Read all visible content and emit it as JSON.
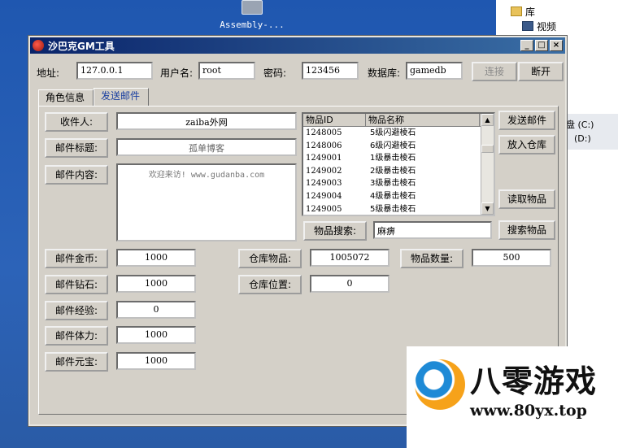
{
  "desktop": {
    "icon_label": "Assembly-...",
    "explorer": {
      "folder_library": "库",
      "folder_video": "视频",
      "drive_c": "盘 (C:)",
      "drive_d": "(D:)"
    }
  },
  "window": {
    "title": "沙巴克GM工具",
    "min_label": "_",
    "max_label": "□",
    "close_label": "×"
  },
  "connection": {
    "address_label": "地址:",
    "address_value": "127.0.0.1",
    "username_label": "用户名:",
    "username_value": "root",
    "password_label": "密码:",
    "password_value": "123456",
    "database_label": "数据库:",
    "database_value": "gamedb",
    "connect_label": "连接",
    "disconnect_label": "断开"
  },
  "tabs": [
    {
      "label": "角色信息"
    },
    {
      "label": "发送邮件"
    }
  ],
  "mail": {
    "recipient_label": "收件人:",
    "recipient_value": "zaiba外网",
    "subject_label": "邮件标题:",
    "subject_value": "孤单博客",
    "content_label": "邮件内容:",
    "content_value": "欢迎来访! www.gudanba.com",
    "gold_label": "邮件金币:",
    "gold_value": "1000",
    "diamond_label": "邮件钻石:",
    "diamond_value": "1000",
    "exp_label": "邮件经验:",
    "exp_value": "0",
    "stamina_label": "邮件体力:",
    "stamina_value": "1000",
    "yuanbao_label": "邮件元宝:",
    "yuanbao_value": "1000"
  },
  "items": {
    "col_id": "物品ID",
    "col_name": "物品名称",
    "rows": [
      {
        "id": "1248005",
        "name": "5级闪避棱石"
      },
      {
        "id": "1248006",
        "name": "6级闪避棱石"
      },
      {
        "id": "1249001",
        "name": "1级暴击棱石"
      },
      {
        "id": "1249002",
        "name": "2级暴击棱石"
      },
      {
        "id": "1249003",
        "name": "3级暴击棱石"
      },
      {
        "id": "1249004",
        "name": "4级暴击棱石"
      },
      {
        "id": "1249005",
        "name": "5级暴击棱石"
      }
    ],
    "search_label": "物品搜索:",
    "search_value": "麻痹",
    "send_mail_button": "发送邮件",
    "put_warehouse_button": "放入仓库",
    "read_items_button": "读取物品",
    "search_button": "搜索物品",
    "warehouse_item_label": "仓库物品:",
    "warehouse_item_value": "1005072",
    "item_count_label": "物品数量:",
    "item_count_value": "500",
    "warehouse_pos_label": "仓库位置:",
    "warehouse_pos_value": "0"
  },
  "watermark": {
    "title": "八零游戏",
    "url": "www.80yx.top"
  }
}
